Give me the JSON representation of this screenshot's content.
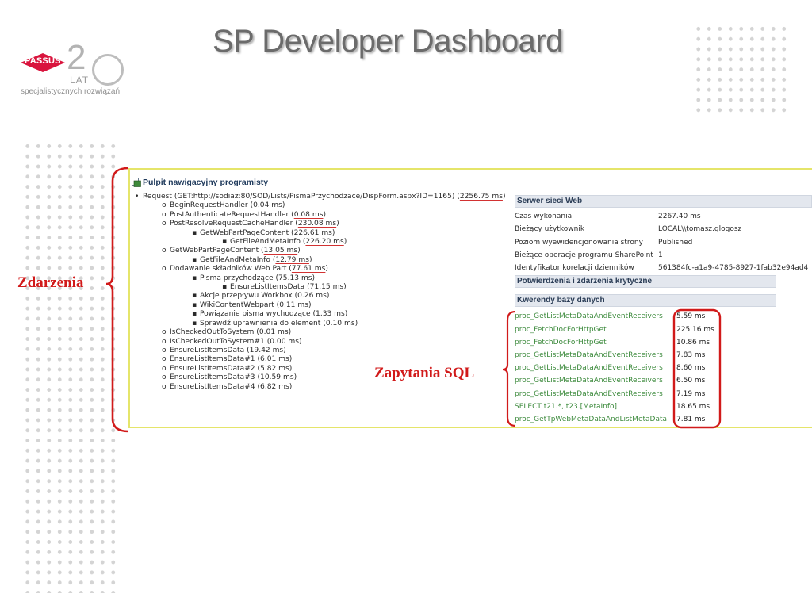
{
  "slide": {
    "title": "SP Developer Dashboard",
    "logo": {
      "badge": "PASSUS",
      "number": "2",
      "lat": "LAT",
      "tagline": "specjalistycznych rozwiązań"
    }
  },
  "dashboard": {
    "title": "Pulpit nawigacyjny programisty",
    "tree": [
      {
        "level": 0,
        "bullet": "•",
        "text": "Request (GET:http://sodiaz:80/SOD/Lists/PismaPrzychodzace/DispForm.aspx?ID=1165) (",
        "time": "2256.75 ms",
        "close": ")",
        "underline": true
      },
      {
        "level": 1,
        "bullet": "o",
        "text": "BeginRequestHandler (",
        "time": "0.04 ms",
        "close": ")",
        "underline": true
      },
      {
        "level": 1,
        "bullet": "o",
        "text": "PostAuthenticateRequestHandler (",
        "time": "0.08 ms",
        "close": ")",
        "underline": true
      },
      {
        "level": 1,
        "bullet": "o",
        "text": "PostResolveRequestCacheHandler (",
        "time": "230.08 ms",
        "close": ")",
        "underline": true
      },
      {
        "level": 2,
        "bullet": "▪",
        "text": "GetWebPartPageContent (",
        "time": "226.61 ms",
        "close": ")",
        "underline": false
      },
      {
        "level": 3,
        "bullet": "▪",
        "text": "GetFileAndMetaInfo (",
        "time": "226.20 ms",
        "close": ")",
        "underline": true
      },
      {
        "level": 1,
        "bullet": "o",
        "text": "GetWebPartPageContent (",
        "time": "13.05 ms",
        "close": ")",
        "underline": true
      },
      {
        "level": 2,
        "bullet": "▪",
        "text": "GetFileAndMetaInfo (",
        "time": "12.79 ms",
        "close": ")",
        "underline": true
      },
      {
        "level": 1,
        "bullet": "o",
        "text": "Dodawanie składników Web Part (",
        "time": "77.61 ms",
        "close": ")",
        "underline": true
      },
      {
        "level": 2,
        "bullet": "▪",
        "text": "Pisma przychodzące (",
        "time": "75.13 ms",
        "close": ")",
        "underline": false
      },
      {
        "level": 3,
        "bullet": "▪",
        "text": "EnsureListItemsData (",
        "time": "71.15 ms",
        "close": ")",
        "underline": false
      },
      {
        "level": 2,
        "bullet": "▪",
        "text": "Akcje przepływu Workbox (",
        "time": "0.26 ms",
        "close": ")",
        "underline": false
      },
      {
        "level": 2,
        "bullet": "▪",
        "text": "WikiContentWebpart (",
        "time": "0.11 ms",
        "close": ")",
        "underline": false
      },
      {
        "level": 2,
        "bullet": "▪",
        "text": "Powiązanie pisma wychodzące (",
        "time": "1.33 ms",
        "close": ")",
        "underline": false
      },
      {
        "level": 2,
        "bullet": "▪",
        "text": "Sprawdź uprawnienia do element (",
        "time": "0.10 ms",
        "close": ")",
        "underline": false
      },
      {
        "level": 1,
        "bullet": "o",
        "text": "IsCheckedOutToSystem (",
        "time": "0.01 ms",
        "close": ")",
        "underline": false
      },
      {
        "level": 1,
        "bullet": "o",
        "text": "IsCheckedOutToSystem#1 (",
        "time": "0.00 ms",
        "close": ")",
        "underline": false
      },
      {
        "level": 1,
        "bullet": "o",
        "text": "EnsureListItemsData (",
        "time": "19.42 ms",
        "close": ")",
        "underline": false
      },
      {
        "level": 1,
        "bullet": "o",
        "text": "EnsureListItemsData#1 (",
        "time": "6.01 ms",
        "close": ")",
        "underline": false
      },
      {
        "level": 1,
        "bullet": "o",
        "text": "EnsureListItemsData#2 (",
        "time": "5.82 ms",
        "close": ")",
        "underline": false
      },
      {
        "level": 1,
        "bullet": "o",
        "text": "EnsureListItemsData#3 (",
        "time": "10.59 ms",
        "close": ")",
        "underline": false
      },
      {
        "level": 1,
        "bullet": "o",
        "text": "EnsureListItemsData#4 (",
        "time": "6.82 ms",
        "close": ")",
        "underline": false
      }
    ],
    "server": {
      "title": "Serwer sieci Web",
      "rows": [
        {
          "key": "Czas wykonania",
          "value": "2267.40 ms"
        },
        {
          "key": "Bieżący użytkownik",
          "value": "LOCAL\\\\tomasz.glogosz"
        },
        {
          "key": "Poziom wyewidencjonowania strony",
          "value": "Published"
        },
        {
          "key": "Bieżące operacje programu SharePoint",
          "value": "1"
        },
        {
          "key": "Identyfikator korelacji dzienników",
          "value": "561384fc-a1a9-4785-8927-1fab32e94ad4"
        }
      ]
    },
    "assertions": {
      "title": "Potwierdzenia i zdarzenia krytyczne"
    },
    "queries": {
      "title": "Kwerendy bazy danych",
      "rows": [
        {
          "query": "proc_GetListMetaDataAndEventReceivers",
          "time": "5.59 ms"
        },
        {
          "query": "proc_FetchDocForHttpGet",
          "time": "225.16 ms"
        },
        {
          "query": "proc_FetchDocForHttpGet",
          "time": "10.86 ms"
        },
        {
          "query": "proc_GetListMetaDataAndEventReceivers",
          "time": "7.83 ms"
        },
        {
          "query": "proc_GetListMetaDataAndEventReceivers",
          "time": "8.60 ms"
        },
        {
          "query": "proc_GetListMetaDataAndEventReceivers",
          "time": "6.50 ms"
        },
        {
          "query": "proc_GetListMetaDataAndEventReceivers",
          "time": "7.19 ms"
        },
        {
          "query": "SELECT t21.*, t23.[MetaInfo]",
          "time": "18.65 ms"
        },
        {
          "query": "proc_GetTpWebMetaDataAndListMetaData",
          "time": "7.81 ms"
        }
      ]
    }
  },
  "annotations": {
    "events": "Zdarzenia",
    "sql": "Zapytania SQL",
    "color": "#d11a1a"
  }
}
